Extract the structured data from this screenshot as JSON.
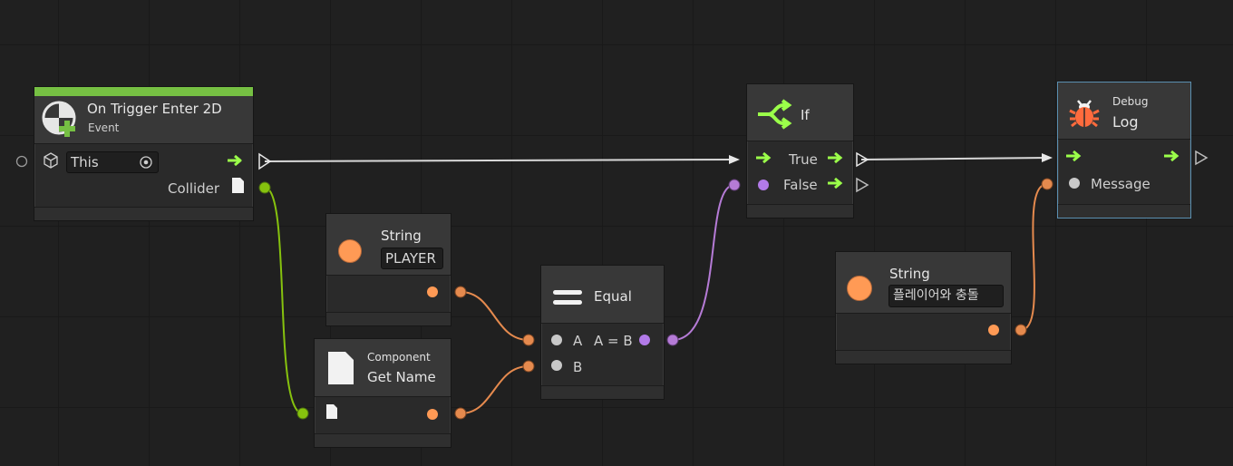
{
  "colors": {
    "flow": "#d8d8d8",
    "flow_arrow": "#9bff4a",
    "collider_wire": "#86c20e",
    "string_wire": "#e58a4e",
    "bool_wire": "#b57bd6",
    "event_bar": "#76c043",
    "string_port": "#ff9a55",
    "bool_port": "#b27ae8",
    "null_port": "#c8c8c8",
    "debug_border": "#5a8fb0"
  },
  "nodes": {
    "trigger": {
      "title": "On Trigger Enter 2D",
      "subtitle": "Event",
      "target_value": "This",
      "output_collider": "Collider",
      "icon": "trigger-event-icon"
    },
    "string_player": {
      "title": "String",
      "value": "PLAYER",
      "icon": "string-icon"
    },
    "get_name": {
      "category": "Component",
      "title": "Get Name",
      "icon": "document-icon"
    },
    "equal": {
      "title": "Equal",
      "input_a": "A",
      "input_b": "B",
      "output": "A = B",
      "icon": "equal-icon"
    },
    "if": {
      "title": "If",
      "output_true": "True",
      "output_false": "False",
      "icon": "branch-icon"
    },
    "string_msg": {
      "title": "String",
      "value": "플레이어와 충돌",
      "icon": "string-icon"
    },
    "debug_log": {
      "category": "Debug",
      "title": "Log",
      "input_message": "Message",
      "icon": "bug-icon"
    }
  }
}
